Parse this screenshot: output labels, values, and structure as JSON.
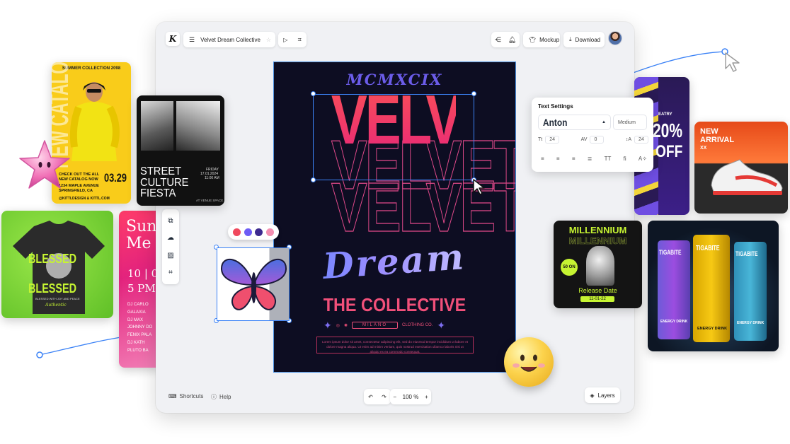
{
  "toolbar": {
    "logo_letter": "K",
    "project_title": "Velvet Dream Collective",
    "mockup_label": "Mockup",
    "download_label": "Download"
  },
  "poster": {
    "year_roman": "MCMXCIX",
    "headline": "VELVET",
    "script_word": "Dream",
    "subtitle": "THE COLLECTIVE",
    "location": "MILANO",
    "brand": "CLOTHING CO.",
    "body_text": "Lorem ipsum dolor sit amet, consectetur adipiscing elit, sed do eiusmod tempor incididunt ut labore et dolore magna aliqua. Ut enim ad minim veniam, quis nostrud exercitation ullamco laboris nisi ut aliquip ex ea commodo consequat."
  },
  "text_settings": {
    "title": "Text Settings",
    "font_family": "Anton",
    "font_weight": "Medium",
    "font_size": "24",
    "letter_spacing": "0",
    "line_height": "24"
  },
  "bottom_bar": {
    "shortcuts_label": "Shortcuts",
    "help_label": "Help",
    "zoom": "100 %",
    "layers_label": "Layers"
  },
  "palette": [
    "#f0495e",
    "#6e5cf5",
    "#3d2a8f",
    "#f48fb1"
  ],
  "cards": {
    "summer": {
      "title": "SUMMER COLLECTION 2098",
      "vertical_text": "NEW CATALOG",
      "catalog_line1": "CHECK OUT THE ALL",
      "catalog_line2": "NEW CATALOG NOW",
      "date": "03.29",
      "address_line1": "1234 MAPLE AVENUE",
      "address_line2": "SPRINGFIELD, CA",
      "handle": "@KITTLDESIGN & KITTL.COM"
    },
    "street": {
      "heading": "STREET CULTURE FIESTA",
      "date_line1": "FRIDAY",
      "date_line2": "17.01.2024",
      "date_line3": "11:00 AM",
      "venue": "AT VENUE SPACE"
    },
    "summer_me": {
      "word1": "Sun",
      "word2": "Me",
      "numbers": "10 | 0",
      "time": "5 PM",
      "names": [
        "DJ CARLO",
        "GALAXIA",
        "DJ MAX",
        "JOHNNY DO",
        "FENIX PALA",
        "DJ KATH",
        "PLUTO BA"
      ]
    },
    "tshirt": {
      "word": "BLESSED",
      "tagline": "BLESSED WITH JOY AND PEACE",
      "signature": "Authentic"
    },
    "sale": {
      "percent": "20%",
      "off": "OFF",
      "side_word": "EATRY"
    },
    "sneaker": {
      "line1": "NEW",
      "line2": "ARRIVAL",
      "brand": "XX"
    },
    "millennium": {
      "title": "MILLENNIUM",
      "badge": "50 ON",
      "release": "Release Date",
      "date": "11-01-22"
    },
    "cans": {
      "brand": "TIGABITE",
      "label": "ENERGY DRINK"
    }
  },
  "colors": {
    "accent_blue": "#3b82f6",
    "poster_bg": "#0d0d22",
    "poster_pink": "#f2507a",
    "poster_purple": "#6b5ce9"
  }
}
